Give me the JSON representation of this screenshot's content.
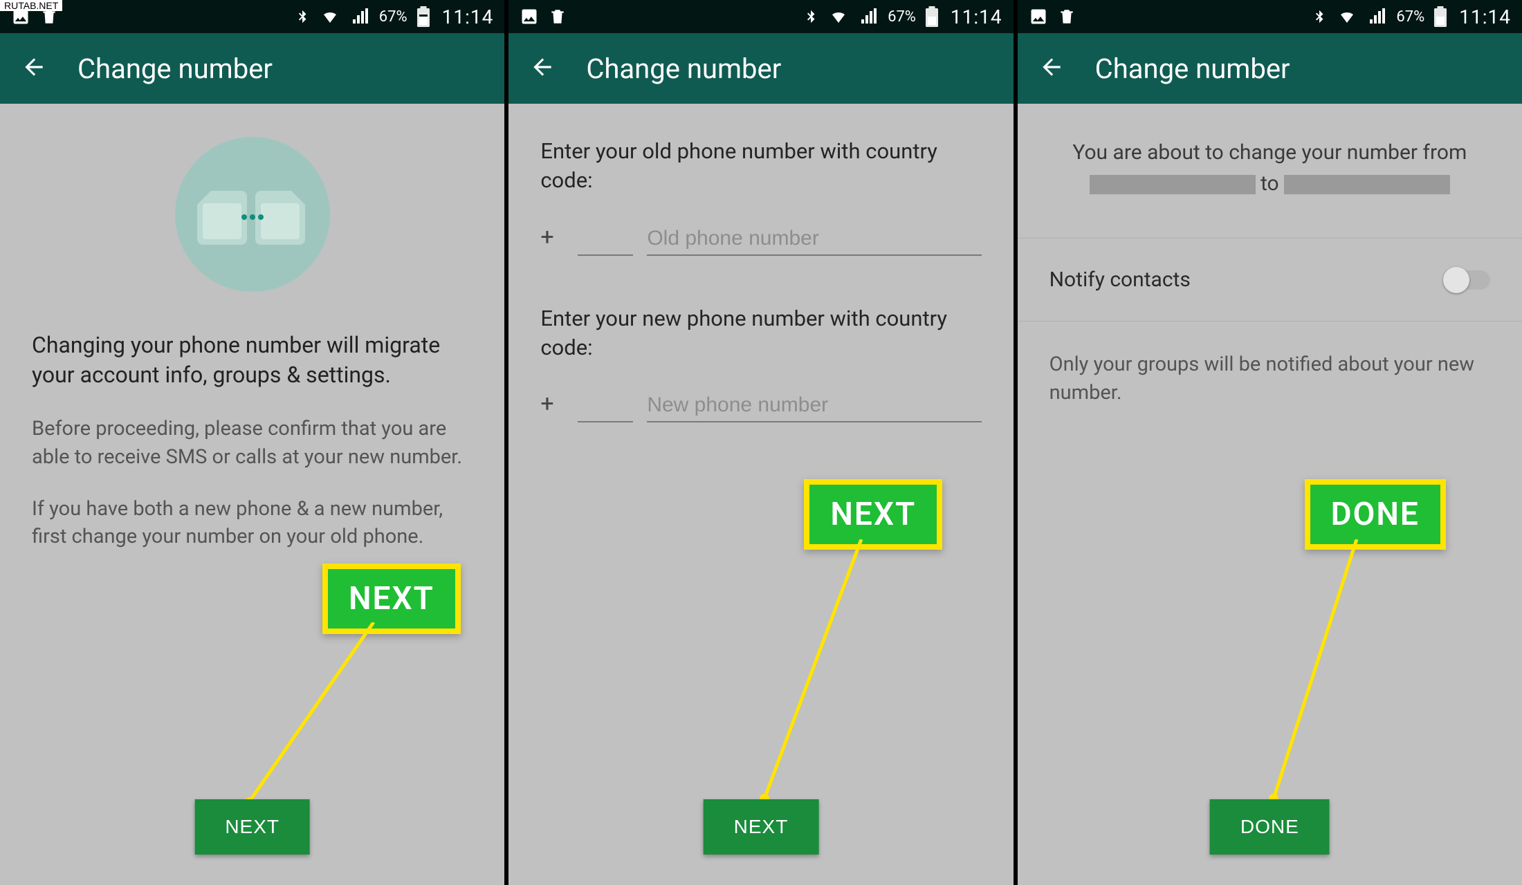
{
  "watermark": "RUTAB.NET",
  "statusbar": {
    "battery_pct": "67%",
    "clock": "11:14"
  },
  "appbar": {
    "title": "Change number"
  },
  "screen1": {
    "lead": "Changing your phone number will migrate your account info, groups & settings.",
    "para1": "Before proceeding, please confirm that you are able to receive SMS or calls at your new number.",
    "para2": "If you have both a new phone & a new number, first change your number on your old phone.",
    "annot_label": "NEXT",
    "button_label": "NEXT"
  },
  "screen2": {
    "label_old": "Enter your old phone number with country code:",
    "label_new": "Enter your new phone number with country code:",
    "cc_prefix": "+",
    "ph_old": "Old phone number",
    "ph_new": "New phone number",
    "annot_label": "NEXT",
    "button_label": "NEXT"
  },
  "screen3": {
    "confirm_a": "You are about to change your number from",
    "confirm_to": "to",
    "notify_label": "Notify contacts",
    "notify_desc": "Only your groups will be notified about your new number.",
    "annot_label": "DONE",
    "button_label": "DONE"
  }
}
